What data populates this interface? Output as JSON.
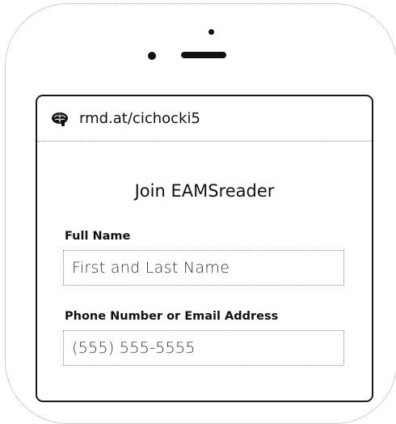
{
  "browser": {
    "url": "rmd.at/cichocki5",
    "site_icon": "brain-icon"
  },
  "form": {
    "title": "Join EAMSreader",
    "full_name": {
      "label": "Full Name",
      "placeholder": "First and Last Name"
    },
    "contact": {
      "label": "Phone Number or Email Address",
      "placeholder": "(555) 555-5555"
    }
  }
}
